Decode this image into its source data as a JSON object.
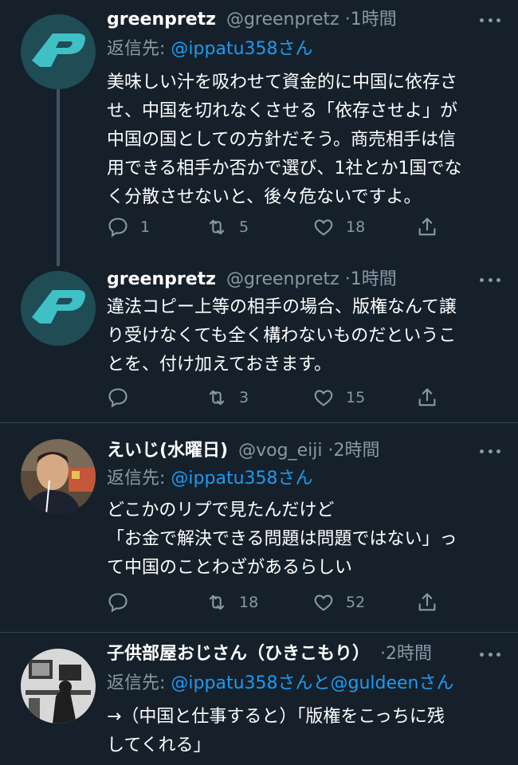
{
  "tweets": [
    {
      "name": "greenpretz",
      "handle": "@greenpretz",
      "time": "·1時間",
      "reply_prefix": "返信先:",
      "reply_to": "@ippatu358さん",
      "text": "美味しい汁を吸わせて資金的に中国に依存さ\nせ、中国を切れなくさせる「依存させよ」が\n中国の国としての方針だそう。商売相手は信\n用できる相手か否かで選び、1社とか1国でな\nく分散させないと、後々危ないですよ。",
      "replies": "1",
      "retweets": "5",
      "likes": "18"
    },
    {
      "name": "greenpretz",
      "handle": "@greenpretz",
      "time": "·1時間",
      "text": "違法コピー上等の相手の場合、版権なんて譲\nり受けなくても全く構わないものだというこ\nとを、付け加えておきます。",
      "replies": "",
      "retweets": "3",
      "likes": "15"
    },
    {
      "name": "えいじ(水曜日)",
      "handle": "@vog_eiji",
      "time": "·2時間",
      "reply_prefix": "返信先:",
      "reply_to": "@ippatu358さん",
      "text": "どこかのリプで見たんだけど\n「お金で解決できる問題は問題ではない」っ\nて中国のことわざがあるらしい",
      "replies": "",
      "retweets": "18",
      "likes": "52"
    },
    {
      "name": "子供部屋おじさん（ひきこもり）",
      "handle": "",
      "time": "·2時間",
      "reply_prefix": "返信先:",
      "reply_to": "@ippatu358さんと@guldeenさん",
      "text": "→（中国と仕事すると）「版権をこっちに残\nしてくれる」"
    }
  ],
  "colors": {
    "background": "#15202b",
    "muted": "#8899a6",
    "link": "#1d9bf0",
    "divider": "#38444d"
  },
  "icons": [
    "reply-icon",
    "retweet-icon",
    "like-icon",
    "share-icon",
    "more-icon"
  ]
}
